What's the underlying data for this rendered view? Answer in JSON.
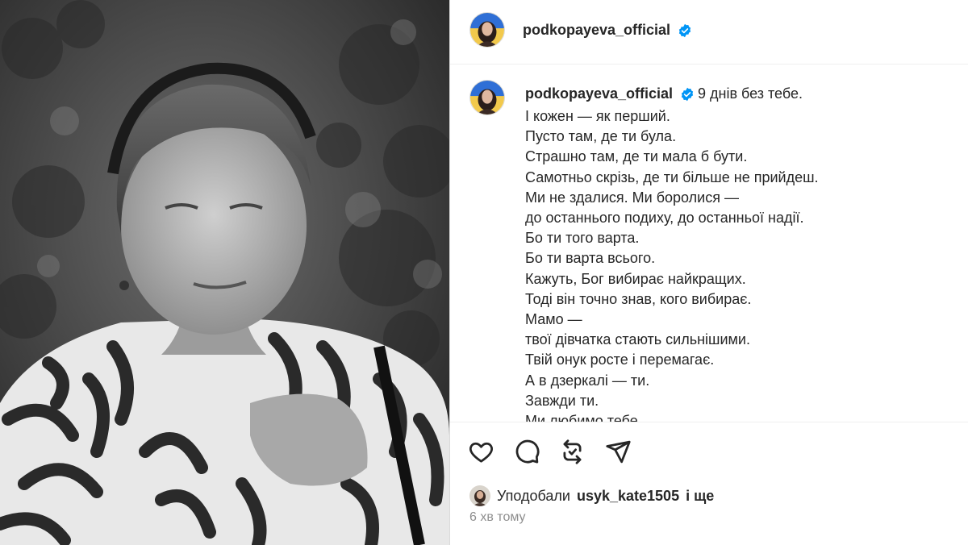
{
  "post": {
    "photo_alt": "portrait",
    "author": {
      "username": "podkopayeva_official",
      "verified": true,
      "avatar_icon": "profile-avatar"
    },
    "caption": {
      "first_line": "9 днів без тебе.",
      "lines": [
        "І кожен — як перший.",
        "Пусто там, де ти була.",
        "Страшно там, де ти мала б бути.",
        "Самотньо скрізь, де ти більше не прийдеш.",
        "Ми не здалися. Ми боролися —",
        "до останнього подиху, до останньої надії.",
        "Бо ти того варта.",
        "Бо ти варта всього.",
        "Кажуть, Бог вибирає найкращих.",
        "Тоді він точно знав, кого вибирає.",
        "Мамо —",
        "твої дівчатка стають сильнішими.",
        "Твій онук росте і перемагає.",
        "А в дзеркалі — ти.",
        "Завжди ти.",
        "Ми любимо тебе."
      ]
    },
    "actions": {
      "like_icon": "heart-icon",
      "comment_icon": "comment-icon",
      "repost_icon": "repost-icon",
      "share_icon": "share-icon"
    },
    "likes": {
      "prefix": "Уподобали",
      "user": "usyk_kate1505",
      "suffix": "і ще"
    },
    "timestamp": "6 хв тому"
  },
  "colors": {
    "verified_badge": "#0095f6",
    "text_primary": "#262626",
    "text_secondary": "#8e8e8e",
    "divider": "#efefef"
  }
}
